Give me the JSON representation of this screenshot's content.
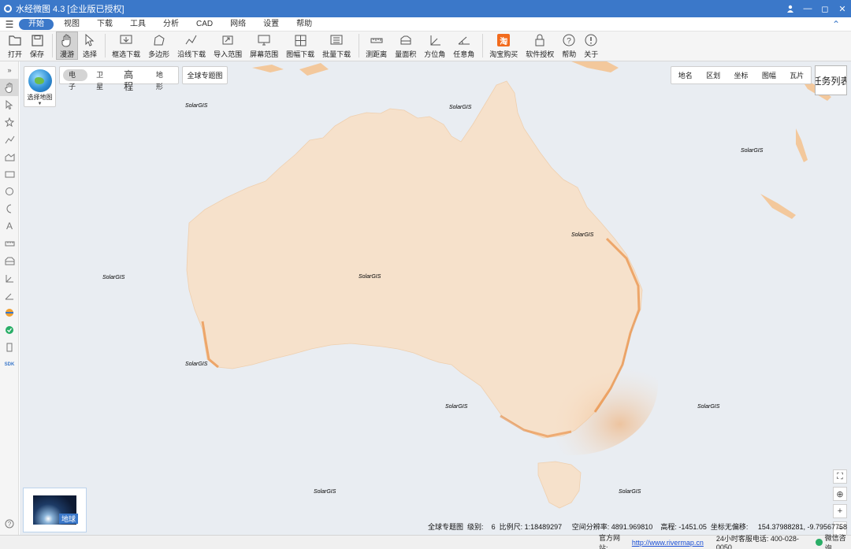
{
  "window": {
    "title": "水经微图 4.3 [企业版已授权]",
    "controls": [
      "user-icon",
      "minimize-icon",
      "maximize-icon",
      "close-icon"
    ]
  },
  "menu": {
    "items": [
      "开始",
      "视图",
      "下载",
      "工具",
      "分析",
      "CAD",
      "网络",
      "设置",
      "帮助"
    ],
    "active": "开始"
  },
  "toolbar": {
    "items": [
      {
        "label": "打开",
        "icon": "folder-icon"
      },
      {
        "label": "保存",
        "icon": "save-icon"
      },
      {
        "label": "漫游",
        "icon": "hand-icon"
      },
      {
        "label": "选择",
        "icon": "cursor-icon"
      },
      {
        "label": "框选下载",
        "icon": "box-download-icon"
      },
      {
        "label": "多边形",
        "icon": "polygon-icon"
      },
      {
        "label": "沿线下载",
        "icon": "line-download-icon"
      },
      {
        "label": "导入范围",
        "icon": "import-icon"
      },
      {
        "label": "屏幕范围",
        "icon": "screen-icon"
      },
      {
        "label": "图幅下载",
        "icon": "grid-icon"
      },
      {
        "label": "批量下载",
        "icon": "batch-icon"
      },
      {
        "label": "测距离",
        "icon": "ruler-icon"
      },
      {
        "label": "量面积",
        "icon": "area-icon"
      },
      {
        "label": "方位角",
        "icon": "azimuth-icon"
      },
      {
        "label": "任意角",
        "icon": "angle-icon"
      },
      {
        "label": "淘宝购买",
        "icon": "taobao-icon"
      },
      {
        "label": "软件授权",
        "icon": "lock-icon"
      },
      {
        "label": "帮助",
        "icon": "help-icon"
      },
      {
        "label": "关于",
        "icon": "info-icon"
      }
    ],
    "taobao_glyph": "淘"
  },
  "map_selector": {
    "label": "选择地图"
  },
  "map_types": {
    "items": [
      "电子",
      "卫星",
      "高程",
      "地形"
    ],
    "active": "电子"
  },
  "thematic": {
    "label": "全球专题图"
  },
  "search_tabs": {
    "items": [
      "地名",
      "区划",
      "坐标",
      "图幅",
      "瓦片"
    ]
  },
  "task_list": {
    "label": "任务列表"
  },
  "mini_globe": {
    "label": "地球"
  },
  "watermark": "SolarGIS",
  "status": {
    "map_name": "全球专题图",
    "level_label": "级别:",
    "level": "6",
    "scale_label": "比例尺:",
    "scale": "1:18489297",
    "resolution_label": "空间分辨率:",
    "resolution": "4891.969810",
    "elevation_label": "高程:",
    "elevation": "-1451.05",
    "coord_label": "坐标无偏移:",
    "coord": "154.37988281, -9.79567758"
  },
  "footer": {
    "site_label": "官方网站:",
    "site_url": "http://www.rivermap.cn",
    "phone": "24小时客服电话:  400-028-0050",
    "wechat": "微信咨询"
  },
  "colors": {
    "accent": "#3b78c9",
    "land": "#f6e1cb",
    "ocean": "#e9edf2",
    "hotspot": "#e5761c"
  }
}
